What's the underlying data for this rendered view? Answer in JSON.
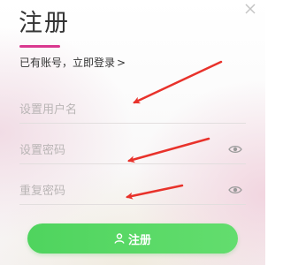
{
  "dialog": {
    "title": "注册",
    "login_prompt": "已有账号，立即登录",
    "login_chevron": ">",
    "close_icon": "close-icon"
  },
  "form": {
    "username": {
      "placeholder": "设置用户名",
      "value": ""
    },
    "password": {
      "placeholder": "设置密码",
      "value": "",
      "toggle_icon": "eye-icon"
    },
    "confirm_password": {
      "placeholder": "重复密码",
      "value": "",
      "toggle_icon": "eye-icon"
    }
  },
  "actions": {
    "register_label": "注册",
    "register_icon": "user-icon"
  },
  "colors": {
    "accent_underline": "#d9388f",
    "button_green": "#55d762",
    "annotation_arrow": "#e8322b"
  }
}
